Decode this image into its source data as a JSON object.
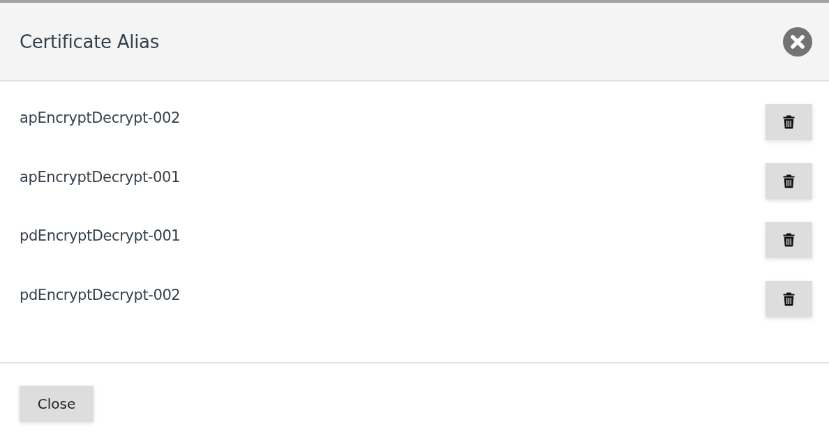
{
  "dialog": {
    "title": "Certificate Alias",
    "aliases": [
      {
        "name": "apEncryptDecrypt-002"
      },
      {
        "name": "apEncryptDecrypt-001"
      },
      {
        "name": "pdEncryptDecrypt-001"
      },
      {
        "name": "pdEncryptDecrypt-002"
      }
    ],
    "buttons": [
      "Close"
    ]
  }
}
